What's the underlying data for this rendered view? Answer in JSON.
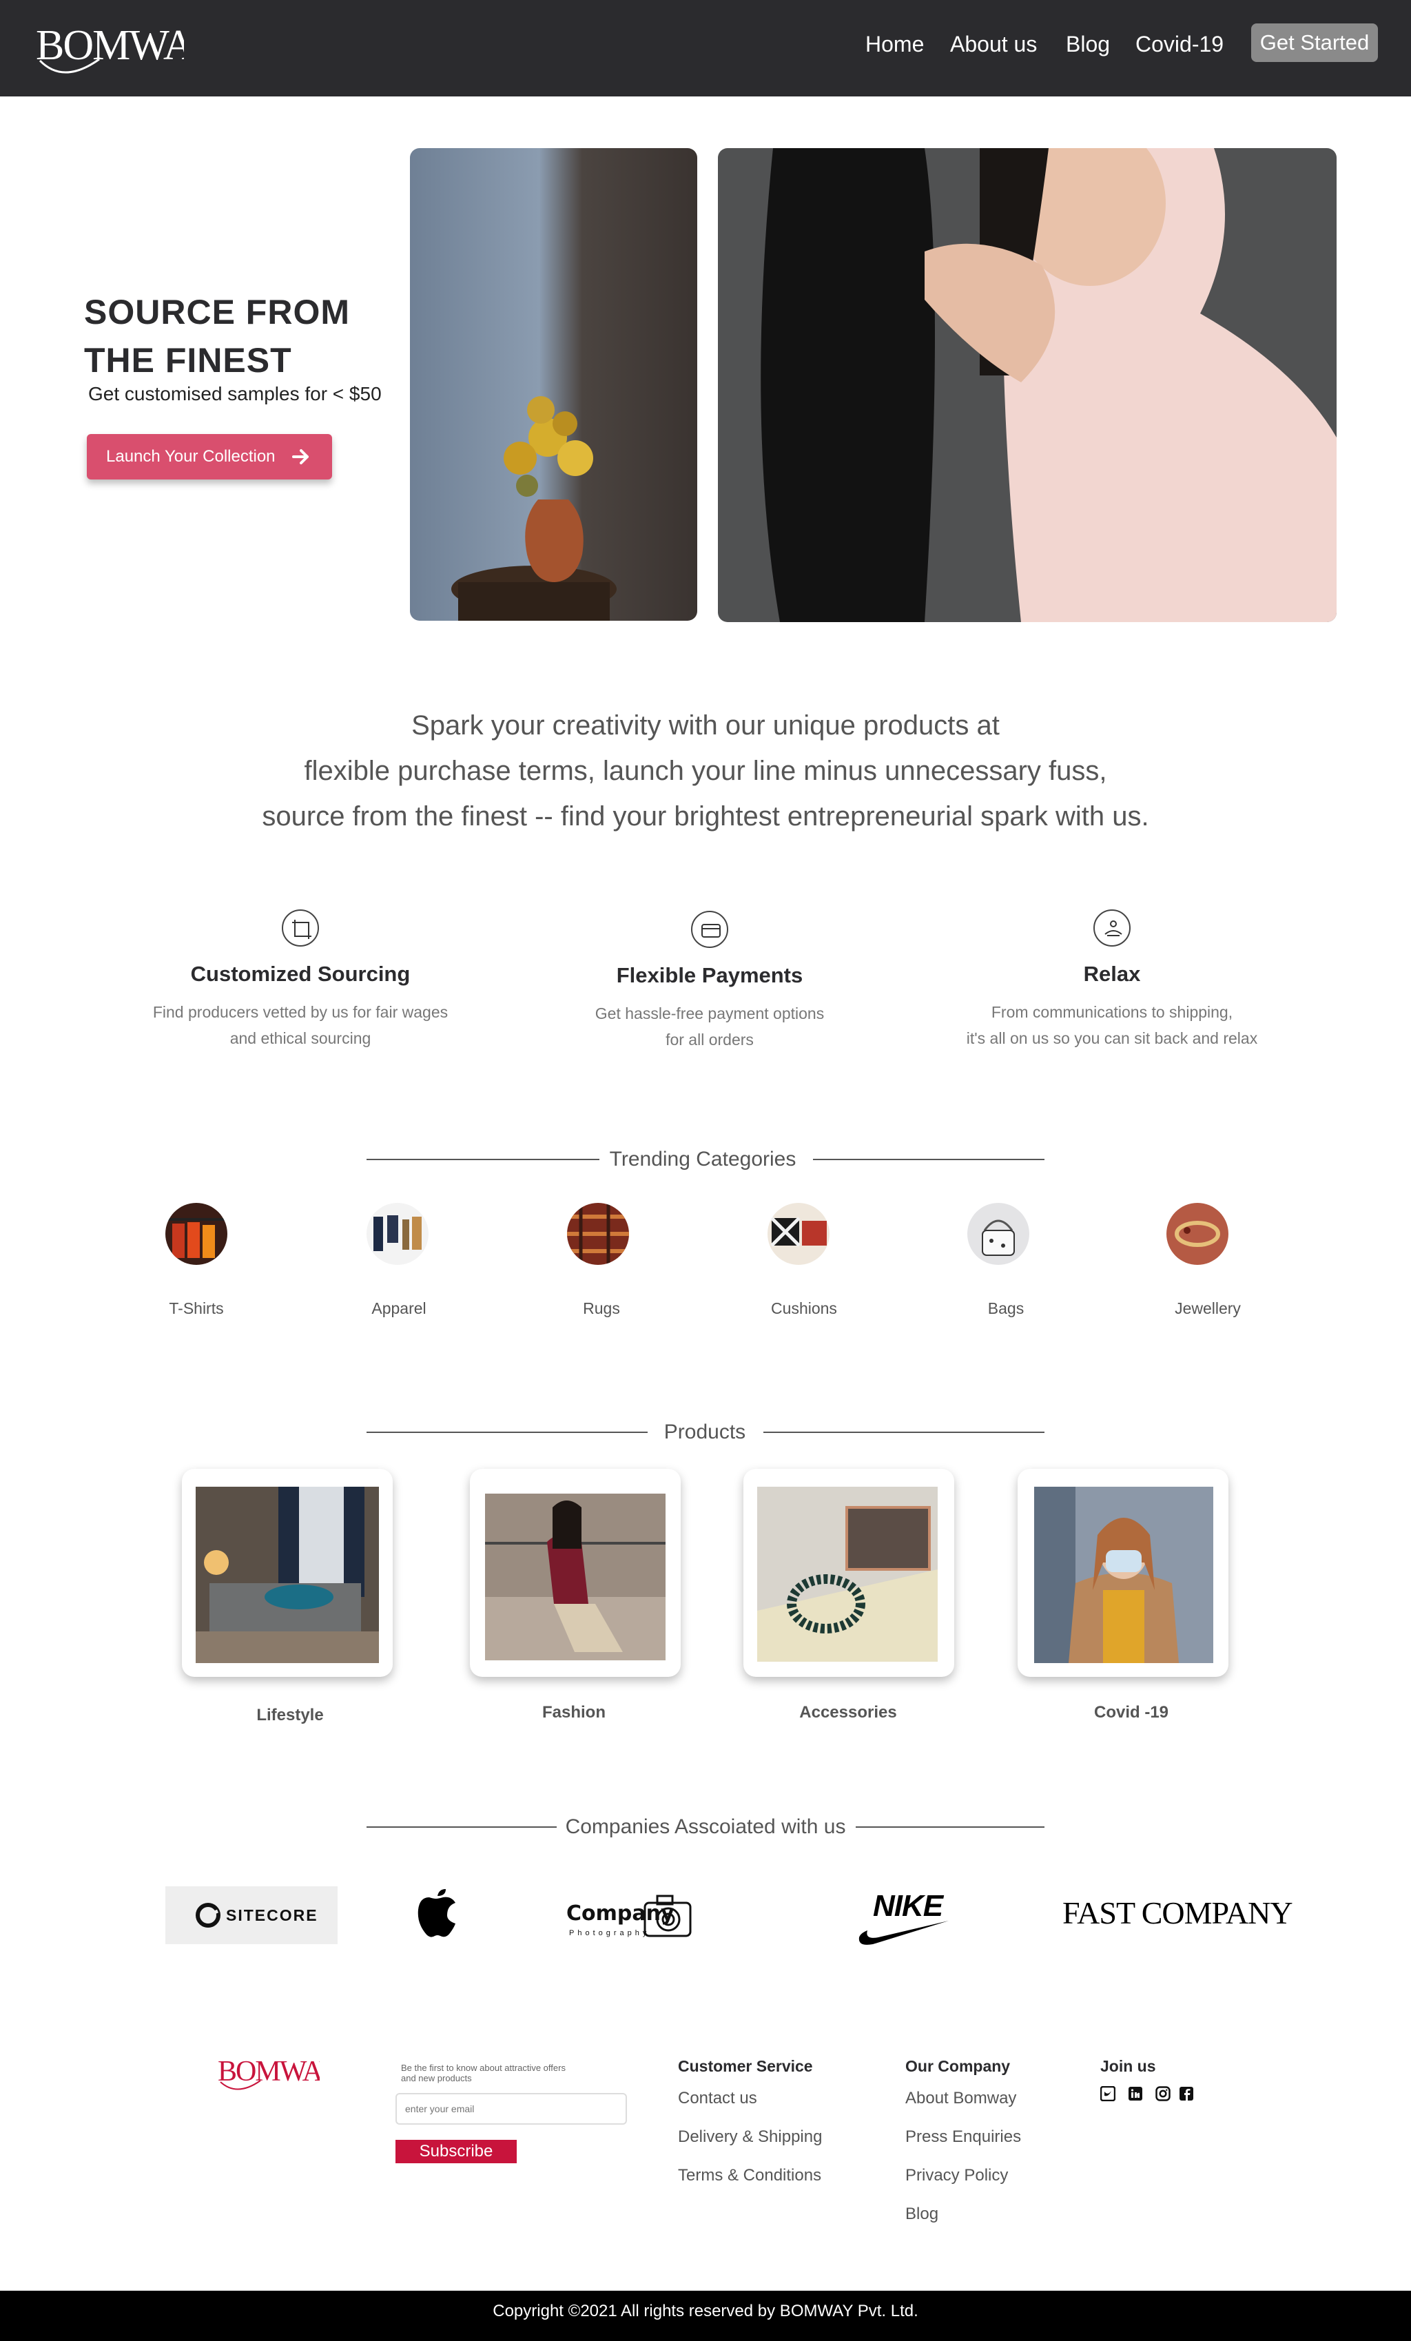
{
  "brand": {
    "name": "BOMWAY",
    "nav_color": "#2b2b2e",
    "accent": "#d94f6e",
    "footer_accent": "#c8143c"
  },
  "nav": {
    "links": [
      "Home",
      "About us",
      "Blog",
      "Covid-19"
    ],
    "cta": "Get Started"
  },
  "hero": {
    "title": "SOURCE  FROM\nTHE FINEST",
    "subtitle": "Get customised samples for < $50",
    "button_label": "Launch Your Collection",
    "button_icon": "arrow-right-icon"
  },
  "tagline": [
    "Spark your creativity with our unique products at",
    "flexible purchase terms, launch your line minus unnecessary fuss,",
    "source from the finest -- find your brightest entrepreneurial spark with us."
  ],
  "features": [
    {
      "title": "Customized Sourcing",
      "desc": "Find producers vetted by us for fair wages\nand ethical sourcing",
      "icon": "crop-icon"
    },
    {
      "title": "Flexible Payments",
      "desc": "Get hassle-free payment options\nfor all orders",
      "icon": "credit-card-icon"
    },
    {
      "title": "Relax",
      "desc": "From communications to shipping,\nit's all on us so you can sit back and relax",
      "icon": "relax-icon"
    }
  ],
  "categories": {
    "heading": "Trending Categories",
    "items": [
      "T-Shirts",
      "Apparel",
      "Rugs",
      "Cushions",
      "Bags",
      "Jewellery"
    ]
  },
  "products": {
    "heading": "Products",
    "items": [
      "Lifestyle",
      "Fashion",
      "Accessories",
      "Covid -19"
    ]
  },
  "companies": {
    "heading": "Companies Asscoiated with us",
    "logos": [
      "SITECORE",
      "apple-logo",
      "Company",
      "NIKE",
      "FAST COMPANY"
    ],
    "photography_caption": "Photography"
  },
  "footer": {
    "newsletter_text": "Be the first to know about attractive offers\n and new products",
    "email_placeholder": "enter your email",
    "subscribe_label": "Subscribe",
    "customer_service": {
      "heading": "Customer Service",
      "links": [
        "Contact us",
        "Delivery & Shipping",
        "Terms & Conditions"
      ]
    },
    "our_company": {
      "heading": "Our Company",
      "links": [
        "About Bomway",
        "Press Enquiries",
        "Privacy Policy",
        "Blog"
      ]
    },
    "join_us": {
      "heading": "Join us",
      "icons": [
        "twitter-icon",
        "linkedin-icon",
        "instagram-icon",
        "facebook-icon"
      ]
    }
  },
  "copyright": "Copyright ©2021 All rights reserved by BOMWAY Pvt. Ltd."
}
